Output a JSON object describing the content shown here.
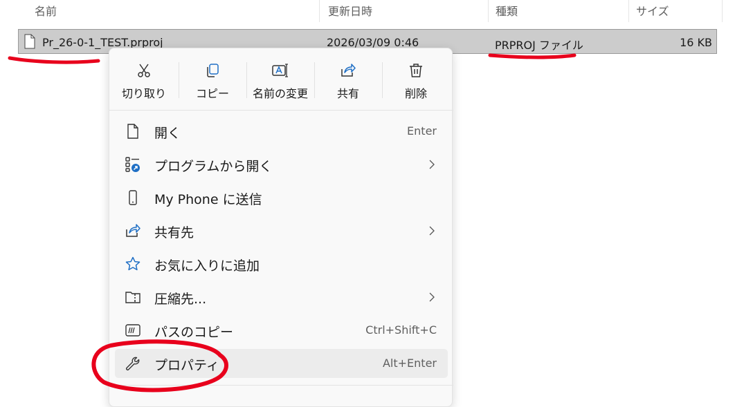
{
  "columns": {
    "name": "名前",
    "modified": "更新日時",
    "type": "種類",
    "size": "サイズ"
  },
  "file": {
    "name": "Pr_26-0-1_TEST.prproj",
    "modified": "2026/03/09 0:46",
    "type": "PRPROJ ファイル",
    "size": "16 KB"
  },
  "quick_actions": [
    {
      "label": "切り取り",
      "icon": "scissors-icon"
    },
    {
      "label": "コピー",
      "icon": "copy-icon"
    },
    {
      "label": "名前の変更",
      "icon": "rename-icon"
    },
    {
      "label": "共有",
      "icon": "share-icon"
    },
    {
      "label": "削除",
      "icon": "trash-icon"
    }
  ],
  "menu_items": [
    {
      "label": "開く",
      "shortcut": "Enter",
      "icon": "document-icon"
    },
    {
      "label": "プログラムから開く",
      "submenu": true,
      "icon": "open-with-icon"
    },
    {
      "label": "My Phone に送信",
      "icon": "phone-icon"
    },
    {
      "label": "共有先",
      "submenu": true,
      "icon": "share-icon"
    },
    {
      "label": "お気に入りに追加",
      "icon": "star-icon"
    },
    {
      "label": "圧縮先...",
      "submenu": true,
      "icon": "zip-folder-icon"
    },
    {
      "label": "パスのコピー",
      "shortcut": "Ctrl+Shift+C",
      "icon": "copy-path-icon"
    },
    {
      "label": "プロパティ",
      "shortcut": "Alt+Enter",
      "icon": "wrench-icon"
    }
  ],
  "colors": {
    "annotation": "#e8001c",
    "selection": "#cccccc",
    "share_accent": "#1f6fc5"
  }
}
